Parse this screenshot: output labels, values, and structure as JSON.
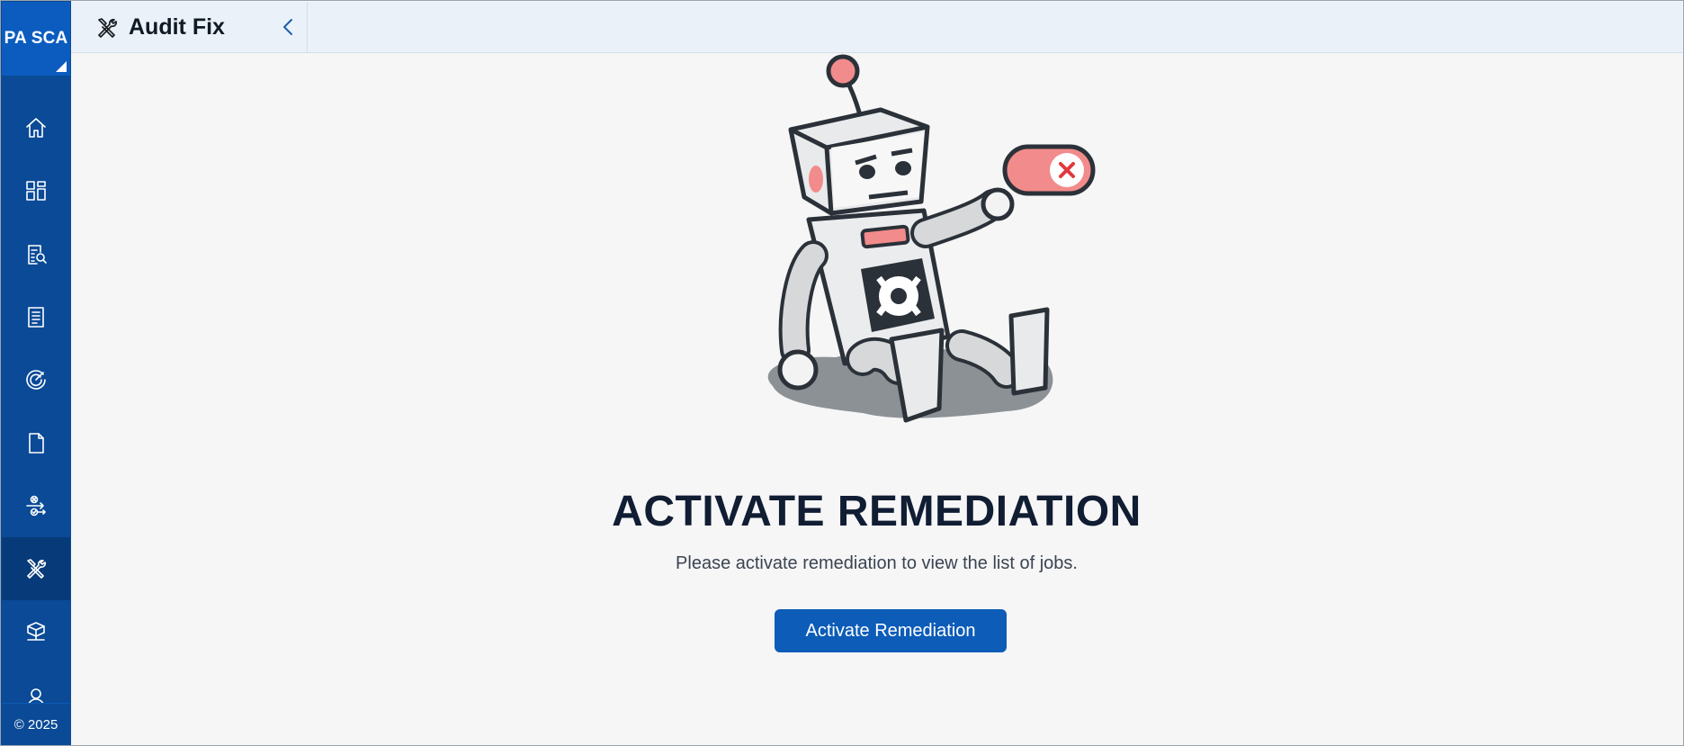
{
  "app": {
    "brand": "PA SCA",
    "copyright": "© 2025"
  },
  "sidebar": {
    "items": [
      {
        "icon": "home-icon",
        "label": "Home"
      },
      {
        "icon": "dashboard-icon",
        "label": "Dashboard"
      },
      {
        "icon": "audit-report-icon",
        "label": "Audit"
      },
      {
        "icon": "document-list-icon",
        "label": "Reports"
      },
      {
        "icon": "gauge-icon",
        "label": "Monitoring"
      },
      {
        "icon": "file-icon",
        "label": "Files"
      },
      {
        "icon": "workflow-icon",
        "label": "Workflow"
      },
      {
        "icon": "tools-icon",
        "label": "Audit Fix"
      },
      {
        "icon": "deploy-box-icon",
        "label": "Deploy"
      },
      {
        "icon": "user-icon",
        "label": "Profile"
      }
    ],
    "active_index": 7
  },
  "header": {
    "title": "Audit Fix",
    "icon": "tools-icon"
  },
  "main": {
    "illustration": "robot-illustration",
    "title": "ACTIVATE REMEDIATION",
    "description": "Please activate remediation to view the list of jobs.",
    "button_label": "Activate Remediation"
  },
  "colors": {
    "sidebar": "#0a4a97",
    "brand": "#0c5cc0",
    "active_nav": "#073a78",
    "header": "#eaf1f8",
    "primary_button": "#0c5cb8",
    "title_text": "#101d33"
  }
}
